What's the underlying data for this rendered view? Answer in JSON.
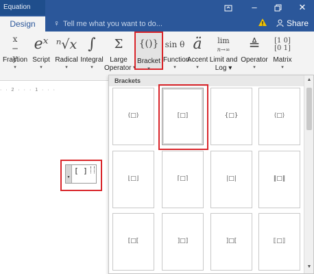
{
  "titlebar": {
    "context_label": "Equation Tools",
    "icons": [
      "restore-ribbon-icon",
      "minimize-icon",
      "maximize-icon",
      "close-icon"
    ]
  },
  "tabs": {
    "design": "Design",
    "tell_me": "Tell me what you want to do...",
    "share": "Share"
  },
  "ribbon": {
    "buttons": [
      {
        "label": "Fraction",
        "icon_text": "x/y"
      },
      {
        "label": "Script",
        "icon_text": "eˣ"
      },
      {
        "label": "Radical",
        "icon_text": "ⁿ√x"
      },
      {
        "label": "Integral",
        "icon_text": "∫"
      },
      {
        "label": "Large",
        "label2": "Operator",
        "icon_text": "Σ"
      },
      {
        "label": "Bracket",
        "icon_text": "{()}"
      },
      {
        "label": "Function",
        "icon_text": "sin θ"
      },
      {
        "label": "Accent",
        "icon_text": "ä"
      },
      {
        "label": "Limit and",
        "label2": "Log",
        "icon_text": "lim"
      },
      {
        "label": "Operator",
        "icon_text": "≜"
      },
      {
        "label": "Matrix",
        "icon_text": "[10 01]"
      }
    ]
  },
  "ruler": {
    "text": "· · 2 · · · 1 · · ·"
  },
  "equation": {
    "content": "[ ]"
  },
  "gallery": {
    "header": "Brackets",
    "rows": [
      [
        "(□)",
        "[□]",
        "{□}",
        "⟨□⟩"
      ],
      [
        "⌊□⌋",
        "⌈□⌉",
        "|□|",
        "‖□‖"
      ],
      [
        "[□[",
        "]□]",
        "]□[",
        "⟦□⟧"
      ]
    ],
    "selected": "[□]"
  },
  "colors": {
    "accent": "#2b579a",
    "highlight": "#d9252a"
  }
}
